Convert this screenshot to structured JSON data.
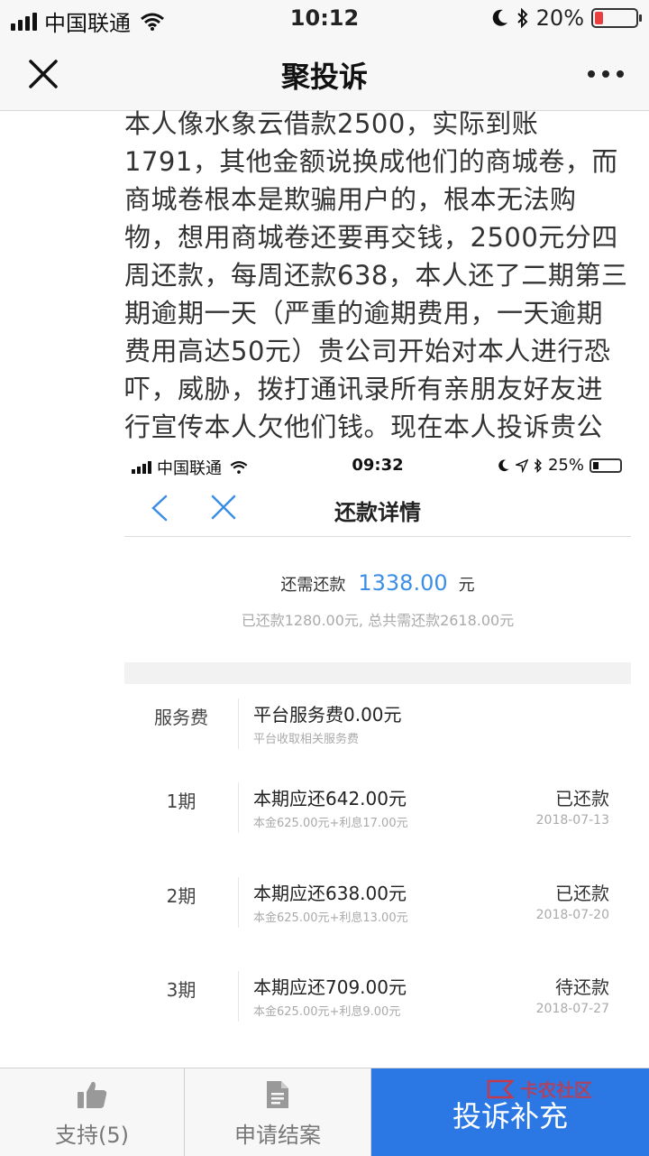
{
  "status_bar": {
    "carrier": "中国联通",
    "time": "10:12",
    "battery_percent": "20%"
  },
  "nav": {
    "title": "聚投诉"
  },
  "complaint": {
    "text": "本人像水象云借款2500，实际到账1791，其他金额说换成他们的商城卷，而商城卷根本是欺骗用户的，根本无法购物，想用商城卷还要再交钱，2500元分四周还款，每周还款638，本人还了二期第三期逾期一天（严重的逾期费用，一天逾期费用高达50元）贵公司开始对本人进行恐吓，威胁，拨打通讯录所有亲朋友好友进行宣传本人欠他们钱。现在本人投诉贵公司超高利息的高利贷，违法的暴力催收并保留起诉贵公司的权利！"
  },
  "embedded": {
    "status_bar": {
      "carrier": "中国联通",
      "time": "09:32",
      "battery_percent": "25%"
    },
    "title": "还款详情",
    "remaining_label": "还需还款",
    "remaining_amount": "1338.00",
    "remaining_unit": "元",
    "paid_summary": "已还款1280.00元, 总共需还款2618.00元",
    "rows": [
      {
        "label": "服务费",
        "main": "平台服务费0.00元",
        "sub": "平台收取相关服务费",
        "status": "",
        "date": ""
      },
      {
        "label": "1期",
        "main": "本期应还642.00元",
        "sub": "本金625.00元+利息17.00元",
        "status": "已还款",
        "date": "2018-07-13"
      },
      {
        "label": "2期",
        "main": "本期应还638.00元",
        "sub": "本金625.00元+利息13.00元",
        "status": "已还款",
        "date": "2018-07-20"
      },
      {
        "label": "3期",
        "main": "本期应还709.00元",
        "sub": "本金625.00元+利息9.00元",
        "status": "待还款",
        "date": "2018-07-27"
      }
    ]
  },
  "toolbar": {
    "support_label": "支持(5)",
    "close_case_label": "申请结案",
    "supplement_label": "投诉补充",
    "watermark": "卡农社区"
  },
  "colors": {
    "accent_blue": "#2b78e4",
    "amount_blue": "#3a8ee6",
    "battery_red": "#e84040"
  }
}
